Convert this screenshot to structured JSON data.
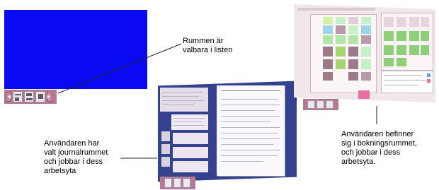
{
  "captions": {
    "rooms": [
      "Rummen är",
      "valbara i listen"
    ],
    "journal": [
      "Användaren har",
      "valt journalrummet",
      "och jobbar i dess",
      "arbetsyta"
    ],
    "booking": [
      "Användaren befinner",
      "sig i bokningsrummet,",
      "och jobbar i dess",
      "arbetsyta."
    ]
  },
  "colors": {
    "workspace_blue": "#0a0af2",
    "navbar_pink": "#b47a94",
    "journal_bg": "#33418f",
    "booking_bg": "#f1e6ea"
  }
}
